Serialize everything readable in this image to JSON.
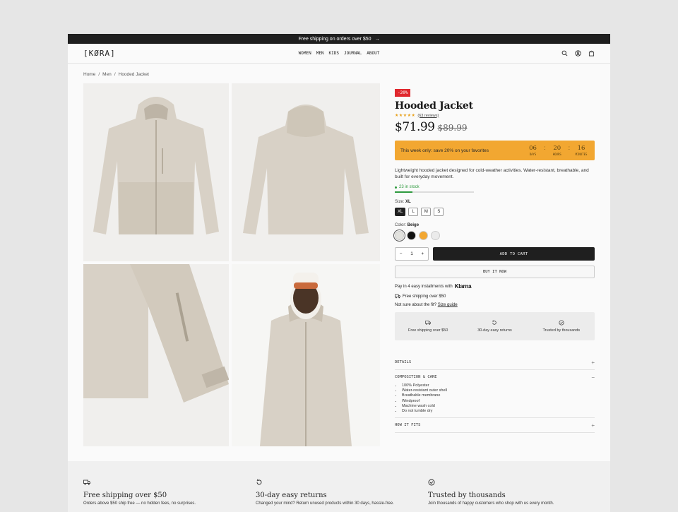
{
  "announcement": {
    "text": "Free shipping on orders over $50",
    "arrow": "→"
  },
  "header": {
    "logo": "[KØRA]",
    "nav": [
      "WOMEN",
      "MEN",
      "KIDS",
      "JOURNAL",
      "ABOUT"
    ],
    "icons": [
      "search-icon",
      "account-icon",
      "bag-icon"
    ]
  },
  "breadcrumb": [
    "Home",
    "/",
    "Men",
    "/",
    "Hooded Jacket"
  ],
  "gallery": {
    "images": [
      "jacket-front",
      "jacket-back",
      "sleeve-detail",
      "model-wearing-jacket"
    ],
    "colors": {
      "tile": "#f0efed",
      "fabric": "#d8d1c6"
    }
  },
  "product": {
    "badge": "-20%",
    "title": "Hooded Jacket",
    "stars": "★★★★★",
    "reviews": "(63 reviews)",
    "price": "$71.99",
    "old_price": "$89.99",
    "promo": {
      "text": "This week only: save 20% on your favorites",
      "timer": [
        {
          "value": "06",
          "label": "DAYS"
        },
        {
          "value": "20",
          "label": "HOURS"
        },
        {
          "value": "16",
          "label": "MINUTES"
        }
      ],
      "separator": ":"
    },
    "description": "Lightweight hooded jacket designed for cold-weather activities. Water-resistant, breathable, and built for everyday movement.",
    "stock": {
      "text": "23 in stock",
      "level": 0.22
    },
    "size": {
      "label": "Size:",
      "selected": "XL",
      "options": [
        "XL",
        "L",
        "M",
        "S"
      ]
    },
    "color": {
      "label": "Color:",
      "selected": "Beige",
      "swatches": [
        "#e2e2de",
        "#111111",
        "#f2a731",
        "#ebebeb"
      ]
    },
    "quantity": {
      "minus": "−",
      "value": "1",
      "plus": "+"
    },
    "add_to_cart": "ADD TO CART",
    "buy_now": "BUY IT NOW",
    "installments": {
      "text": "Pay in 4 easy installments with",
      "provider": "Klarna"
    },
    "shipping_line": "Free shipping over $50",
    "fit": {
      "text": "Not sure about the fit?",
      "link": "Size guide"
    },
    "trust": [
      {
        "icon": "truck-icon",
        "label": "Free shipping over $50"
      },
      {
        "icon": "return-icon",
        "label": "30-day easy returns"
      },
      {
        "icon": "check-circle-icon",
        "label": "Trusted by thousands"
      }
    ],
    "accordion": [
      {
        "title": "DETAILS",
        "sign": "+",
        "open": false
      },
      {
        "title": "COMPOSITION & CARE",
        "sign": "−",
        "open": true,
        "items": [
          "100% Polyester",
          "Water-resistant outer shell",
          "Breathable membrane",
          "Windproof",
          "Machine wash cold",
          "Do not tumble dry"
        ]
      },
      {
        "title": "HOW IT FITS",
        "sign": "+",
        "open": false
      }
    ]
  },
  "features": [
    {
      "icon": "truck-icon",
      "title": "Free shipping over $50",
      "text": "Orders above $50 ship free — no hidden fees, no surprises."
    },
    {
      "icon": "return-icon",
      "title": "30-day easy returns",
      "text": "Changed your mind? Return unused products within 30 days, hassle-free."
    },
    {
      "icon": "check-circle-icon",
      "title": "Trusted by thousands",
      "text": "Join thousands of happy customers who shop with us every month."
    }
  ],
  "theme": {
    "dark": "#1f1f1f",
    "promo": "#f2a731",
    "sale": "#e0282e",
    "stock": "#2e9a3e",
    "star": "#e8a019"
  }
}
